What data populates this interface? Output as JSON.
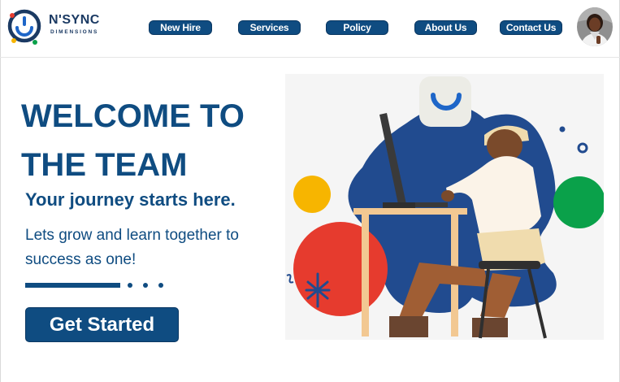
{
  "brand": {
    "name": "N'SYNC",
    "subtitle": "DIMENSIONS",
    "colors": {
      "primary": "#0f4c81",
      "logo_dark": "#1b3a63",
      "accent_red": "#e63b2e",
      "accent_yellow": "#f7b500",
      "accent_green": "#0aa14a",
      "accent_blue": "#1e66c8"
    }
  },
  "nav": {
    "items": [
      {
        "label": "New Hire"
      },
      {
        "label": "Services"
      },
      {
        "label": "Policy"
      },
      {
        "label": "About Us"
      },
      {
        "label": "Contact Us"
      }
    ]
  },
  "user": {
    "avatar": "user-avatar-photo"
  },
  "hero": {
    "title": "WELCOME TO THE TEAM",
    "tagline": "Your journey starts here.",
    "description": "Lets grow and learn together to success as one!",
    "cta_label": "Get Started"
  },
  "illustration": {
    "icon": "person-working-at-computer-illustration"
  }
}
